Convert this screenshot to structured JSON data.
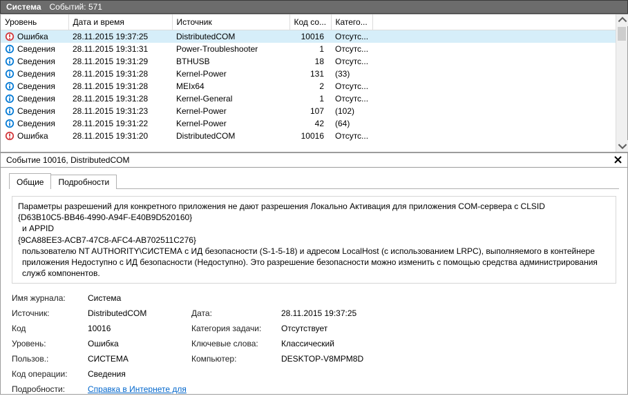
{
  "titlebar": {
    "title": "Система",
    "events_label": "Событий:",
    "events_count": "571"
  },
  "columns": {
    "level": "Уровень",
    "date": "Дата и время",
    "source": "Источник",
    "code": "Код со...",
    "category": "Катего..."
  },
  "rows": [
    {
      "icon": "error",
      "level": "Ошибка",
      "date": "28.11.2015 19:37:25",
      "source": "DistributedCOM",
      "code": "10016",
      "cat": "Отсутс...",
      "selected": true
    },
    {
      "icon": "info",
      "level": "Сведения",
      "date": "28.11.2015 19:31:31",
      "source": "Power-Troubleshooter",
      "code": "1",
      "cat": "Отсутс..."
    },
    {
      "icon": "info",
      "level": "Сведения",
      "date": "28.11.2015 19:31:29",
      "source": "BTHUSB",
      "code": "18",
      "cat": "Отсутс..."
    },
    {
      "icon": "info",
      "level": "Сведения",
      "date": "28.11.2015 19:31:28",
      "source": "Kernel-Power",
      "code": "131",
      "cat": "(33)"
    },
    {
      "icon": "info",
      "level": "Сведения",
      "date": "28.11.2015 19:31:28",
      "source": "MEIx64",
      "code": "2",
      "cat": "Отсутс..."
    },
    {
      "icon": "info",
      "level": "Сведения",
      "date": "28.11.2015 19:31:28",
      "source": "Kernel-General",
      "code": "1",
      "cat": "Отсутс..."
    },
    {
      "icon": "info",
      "level": "Сведения",
      "date": "28.11.2015 19:31:23",
      "source": "Kernel-Power",
      "code": "107",
      "cat": "(102)"
    },
    {
      "icon": "info",
      "level": "Сведения",
      "date": "28.11.2015 19:31:22",
      "source": "Kernel-Power",
      "code": "42",
      "cat": "(64)"
    },
    {
      "icon": "error",
      "level": "Ошибка",
      "date": "28.11.2015 19:31:20",
      "source": "DistributedCOM",
      "code": "10016",
      "cat": "Отсутс..."
    }
  ],
  "details_header": "Событие 10016, DistributedCOM",
  "tabs": {
    "general": "Общие",
    "details": "Подробности"
  },
  "description": {
    "line1": "Параметры разрешений для конкретного приложения не дают разрешения Локально Активация для приложения COM-сервера с CLSID",
    "line2": "{D63B10C5-BB46-4990-A94F-E40B9D520160}",
    "line3": " и APPID",
    "line4": "{9CA88EE3-ACB7-47C8-AFC4-AB702511C276}",
    "line5": " пользователю NT AUTHORITY\\СИСТЕМА с ИД безопасности (S-1-5-18) и адресом LocalHost (с использованием LRPC), выполняемого в контейнере приложения Недоступно с ИД безопасности (Недоступно). Это разрешение безопасности можно изменить с помощью средства администрирования служб компонентов."
  },
  "props": {
    "log_name_lbl": "Имя журнала:",
    "log_name": "Система",
    "source_lbl": "Источник:",
    "source": "DistributedCOM",
    "date_lbl": "Дата:",
    "date": "28.11.2015 19:37:25",
    "code_lbl": "Код",
    "code": "10016",
    "taskcat_lbl": "Категория задачи:",
    "taskcat": "Отсутствует",
    "level_lbl": "Уровень:",
    "level": "Ошибка",
    "keywords_lbl": "Ключевые слова:",
    "keywords": "Классический",
    "user_lbl": "Пользов.:",
    "user": "СИСТЕМА",
    "computer_lbl": "Компьютер:",
    "computer": "DESKTOP-V8MPM8D",
    "opcode_lbl": "Код операции:",
    "opcode": "Сведения",
    "details_lbl": "Подробности:",
    "details_link": "Справка в Интернете для "
  }
}
